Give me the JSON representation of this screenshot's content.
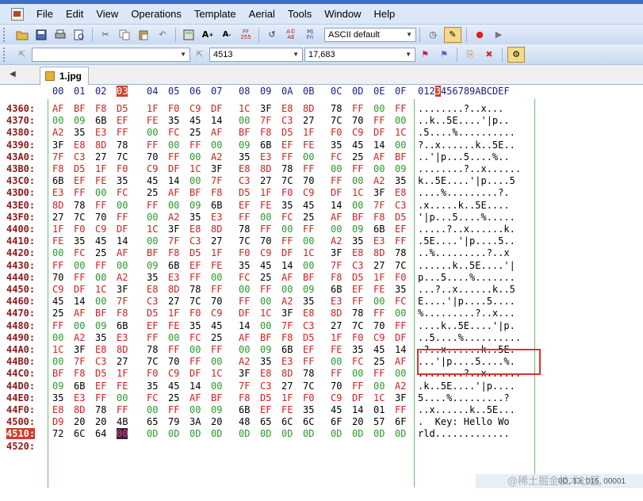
{
  "menu": [
    "File",
    "Edit",
    "View",
    "Operations",
    "Template",
    "Aerial",
    "Tools",
    "Window",
    "Help"
  ],
  "toolbar": {
    "encoding": "ASCII default",
    "address": "4513",
    "value": "17,683"
  },
  "tab": {
    "label": "1.jpg"
  },
  "header": {
    "cols": [
      "00",
      "01",
      "02",
      "03",
      "04",
      "05",
      "06",
      "07",
      "08",
      "09",
      "0A",
      "0B",
      "0C",
      "0D",
      "0E",
      "0F"
    ],
    "ascii_pre": "012",
    "ascii_hl": "3",
    "ascii_post": "456789ABCDEF",
    "highlight_col": 3
  },
  "rows": [
    {
      "a": "4360:",
      "h": [
        "AF",
        "BF",
        "F8",
        "D5",
        "1F",
        "F0",
        "C9",
        "DF",
        "1C",
        "3F",
        "E8",
        "8D",
        "78",
        "FF",
        "00",
        "FF"
      ],
      "t": "........?..x..."
    },
    {
      "a": "4370:",
      "h": [
        "00",
        "09",
        "6B",
        "EF",
        "FE",
        "35",
        "45",
        "14",
        "00",
        "7F",
        "C3",
        "27",
        "7C",
        "70",
        "FF",
        "00"
      ],
      "t": "..k..5E....'|p.."
    },
    {
      "a": "4380:",
      "h": [
        "A2",
        "35",
        "E3",
        "FF",
        "00",
        "FC",
        "25",
        "AF",
        "BF",
        "F8",
        "D5",
        "1F",
        "F0",
        "C9",
        "DF",
        "1C"
      ],
      "t": ".5....%.........."
    },
    {
      "a": "4390:",
      "h": [
        "3F",
        "E8",
        "8D",
        "78",
        "FF",
        "00",
        "FF",
        "00",
        "09",
        "6B",
        "EF",
        "FE",
        "35",
        "45",
        "14",
        "00"
      ],
      "t": "?..x......k..5E.."
    },
    {
      "a": "43A0:",
      "h": [
        "7F",
        "C3",
        "27",
        "7C",
        "70",
        "FF",
        "00",
        "A2",
        "35",
        "E3",
        "FF",
        "00",
        "FC",
        "25",
        "AF",
        "BF"
      ],
      "t": "..'|p...5....%.."
    },
    {
      "a": "43B0:",
      "h": [
        "F8",
        "D5",
        "1F",
        "F0",
        "C9",
        "DF",
        "1C",
        "3F",
        "E8",
        "8D",
        "78",
        "FF",
        "00",
        "FF",
        "00",
        "09"
      ],
      "t": "........?..x......"
    },
    {
      "a": "43C0:",
      "h": [
        "6B",
        "EF",
        "FE",
        "35",
        "45",
        "14",
        "00",
        "7F",
        "C3",
        "27",
        "7C",
        "70",
        "FF",
        "00",
        "A2",
        "35"
      ],
      "t": "k..5E....'|p....5"
    },
    {
      "a": "43D0:",
      "h": [
        "E3",
        "FF",
        "00",
        "FC",
        "25",
        "AF",
        "BF",
        "F8",
        "D5",
        "1F",
        "F0",
        "C9",
        "DF",
        "1C",
        "3F",
        "E8"
      ],
      "t": "....%.........?."
    },
    {
      "a": "43E0:",
      "h": [
        "8D",
        "78",
        "FF",
        "00",
        "FF",
        "00",
        "09",
        "6B",
        "EF",
        "FE",
        "35",
        "45",
        "14",
        "00",
        "7F",
        "C3"
      ],
      "t": ".x.....k..5E...."
    },
    {
      "a": "43F0:",
      "h": [
        "27",
        "7C",
        "70",
        "FF",
        "00",
        "A2",
        "35",
        "E3",
        "FF",
        "00",
        "FC",
        "25",
        "AF",
        "BF",
        "F8",
        "D5"
      ],
      "t": "'|p...5....%....."
    },
    {
      "a": "4400:",
      "h": [
        "1F",
        "F0",
        "C9",
        "DF",
        "1C",
        "3F",
        "E8",
        "8D",
        "78",
        "FF",
        "00",
        "FF",
        "00",
        "09",
        "6B",
        "EF"
      ],
      "t": ".....?..x......k."
    },
    {
      "a": "4410:",
      "h": [
        "FE",
        "35",
        "45",
        "14",
        "00",
        "7F",
        "C3",
        "27",
        "7C",
        "70",
        "FF",
        "00",
        "A2",
        "35",
        "E3",
        "FF"
      ],
      "t": ".5E....'|p....5.."
    },
    {
      "a": "4420:",
      "h": [
        "00",
        "FC",
        "25",
        "AF",
        "BF",
        "F8",
        "D5",
        "1F",
        "F0",
        "C9",
        "DF",
        "1C",
        "3F",
        "E8",
        "8D",
        "78"
      ],
      "t": "..%.........?..x"
    },
    {
      "a": "4430:",
      "h": [
        "FF",
        "00",
        "FF",
        "00",
        "09",
        "6B",
        "EF",
        "FE",
        "35",
        "45",
        "14",
        "00",
        "7F",
        "C3",
        "27",
        "7C"
      ],
      "t": "......k..5E....'|"
    },
    {
      "a": "4440:",
      "h": [
        "70",
        "FF",
        "00",
        "A2",
        "35",
        "E3",
        "FF",
        "00",
        "FC",
        "25",
        "AF",
        "BF",
        "F8",
        "D5",
        "1F",
        "F0"
      ],
      "t": "p...5....%......."
    },
    {
      "a": "4450:",
      "h": [
        "C9",
        "DF",
        "1C",
        "3F",
        "E8",
        "8D",
        "78",
        "FF",
        "00",
        "FF",
        "00",
        "09",
        "6B",
        "EF",
        "FE",
        "35"
      ],
      "t": "...?..x......k..5"
    },
    {
      "a": "4460:",
      "h": [
        "45",
        "14",
        "00",
        "7F",
        "C3",
        "27",
        "7C",
        "70",
        "FF",
        "00",
        "A2",
        "35",
        "E3",
        "FF",
        "00",
        "FC"
      ],
      "t": "E....'|p....5...."
    },
    {
      "a": "4470:",
      "h": [
        "25",
        "AF",
        "BF",
        "F8",
        "D5",
        "1F",
        "F0",
        "C9",
        "DF",
        "1C",
        "3F",
        "E8",
        "8D",
        "78",
        "FF",
        "00"
      ],
      "t": "%.........?..x..."
    },
    {
      "a": "4480:",
      "h": [
        "FF",
        "00",
        "09",
        "6B",
        "EF",
        "FE",
        "35",
        "45",
        "14",
        "00",
        "7F",
        "C3",
        "27",
        "7C",
        "70",
        "FF"
      ],
      "t": "....k..5E....'|p."
    },
    {
      "a": "4490:",
      "h": [
        "00",
        "A2",
        "35",
        "E3",
        "FF",
        "00",
        "FC",
        "25",
        "AF",
        "BF",
        "F8",
        "D5",
        "1F",
        "F0",
        "C9",
        "DF"
      ],
      "t": "..5....%.........."
    },
    {
      "a": "44A0:",
      "h": [
        "1C",
        "3F",
        "E8",
        "8D",
        "78",
        "FF",
        "00",
        "FF",
        "00",
        "09",
        "6B",
        "EF",
        "FE",
        "35",
        "45",
        "14"
      ],
      "t": ".?..x......k..5E."
    },
    {
      "a": "44B0:",
      "h": [
        "00",
        "7F",
        "C3",
        "27",
        "7C",
        "70",
        "FF",
        "00",
        "A2",
        "35",
        "E3",
        "FF",
        "00",
        "FC",
        "25",
        "AF"
      ],
      "t": "...'|p....5....%."
    },
    {
      "a": "44C0:",
      "h": [
        "BF",
        "F8",
        "D5",
        "1F",
        "F0",
        "C9",
        "DF",
        "1C",
        "3F",
        "E8",
        "8D",
        "78",
        "FF",
        "00",
        "FF",
        "00"
      ],
      "t": "........?..x......"
    },
    {
      "a": "44D0:",
      "h": [
        "09",
        "6B",
        "EF",
        "FE",
        "35",
        "45",
        "14",
        "00",
        "7F",
        "C3",
        "27",
        "7C",
        "70",
        "FF",
        "00",
        "A2"
      ],
      "t": ".k..5E....'|p...."
    },
    {
      "a": "44E0:",
      "h": [
        "35",
        "E3",
        "FF",
        "00",
        "FC",
        "25",
        "AF",
        "BF",
        "F8",
        "D5",
        "1F",
        "F0",
        "C9",
        "DF",
        "1C",
        "3F"
      ],
      "t": "5....%.........?"
    },
    {
      "a": "44F0:",
      "h": [
        "E8",
        "8D",
        "78",
        "FF",
        "00",
        "FF",
        "00",
        "09",
        "6B",
        "EF",
        "FE",
        "35",
        "45",
        "14",
        "01",
        "FF"
      ],
      "t": "..x......k..5E..."
    },
    {
      "a": "4500:",
      "h": [
        "D9",
        "20",
        "20",
        "4B",
        "65",
        "79",
        "3A",
        "20",
        "48",
        "65",
        "6C",
        "6C",
        "6F",
        "20",
        "57",
        "6F"
      ],
      "t": ".  Key: Hello Wo"
    },
    {
      "a": "4510:",
      "h": [
        "72",
        "6C",
        "64",
        "00",
        "0D",
        "0D",
        "0D",
        "0D",
        "0D",
        "0D",
        "0D",
        "0D",
        "0D",
        "0D",
        "0D",
        "0D"
      ],
      "t": "rld............."
    },
    {
      "a": "4520:",
      "h": [],
      "t": ""
    }
  ],
  "cursor_row": 27,
  "status": {
    "text": "0D, 13, 015, 00001"
  },
  "watermark": "@稀土掘金技术社区",
  "colors": {
    "accent": "#c8402a",
    "hex_red": "#d02020",
    "hex_green": "#2a9a2a",
    "box": "#e23030"
  }
}
